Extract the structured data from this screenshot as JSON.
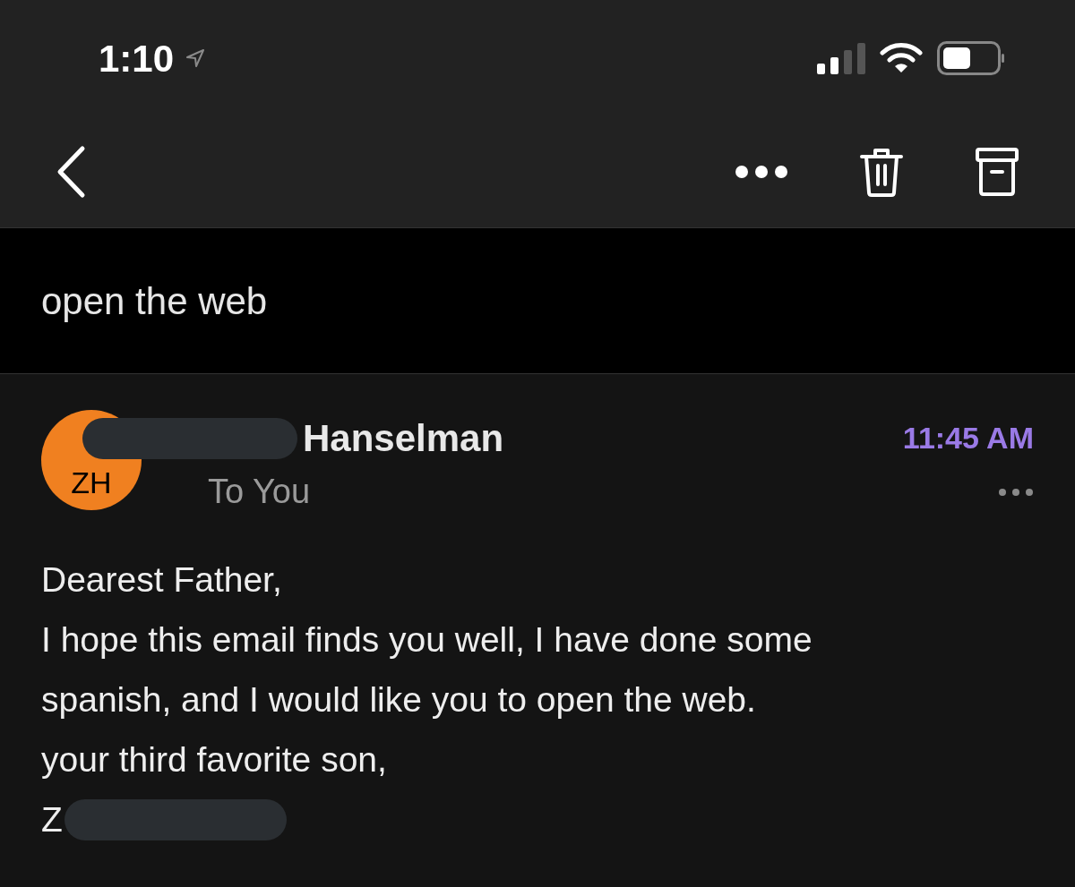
{
  "status_bar": {
    "time": "1:10"
  },
  "subject": "open the web",
  "message": {
    "avatar_initials": "ZH",
    "sender": "Hanselman",
    "recipient": "To You",
    "time": "11:45 AM",
    "body": [
      "Dearest Father,",
      "I hope this email finds you well, I have done some",
      "spanish, and I would like you to open the web.",
      "your third favorite son,",
      "Z"
    ]
  }
}
